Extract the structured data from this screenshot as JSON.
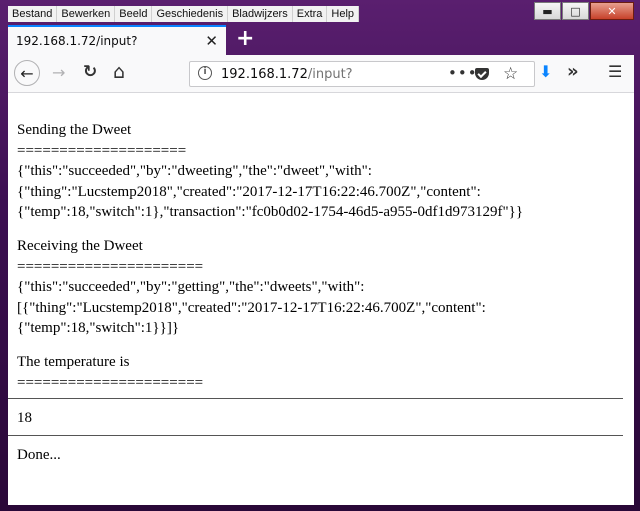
{
  "menu": [
    "Bestand",
    "Bewerken",
    "Beeld",
    "Geschiedenis",
    "Bladwijzers",
    "Extra",
    "Help"
  ],
  "window_controls": {
    "minimize": "▬",
    "maximize": "□",
    "close": "✕"
  },
  "tab": {
    "title": "192.168.1.72/input?",
    "close": "✕"
  },
  "newtab_label": "+",
  "nav": {
    "back": "←",
    "forward": "→",
    "reload": "↻",
    "home": "⌂"
  },
  "urlbar": {
    "host": "192.168.1.72",
    "path": "/input?",
    "info": "i",
    "more": "•••",
    "star": "☆"
  },
  "toolbar_right": {
    "download": "⬇",
    "overflow": "»",
    "menu": "☰"
  },
  "page": {
    "section1_title": "Sending the Dweet",
    "section1_rule": "====================",
    "section1_line1": "{\"this\":\"succeeded\",\"by\":\"dweeting\",\"the\":\"dweet\",\"with\":",
    "section1_line2": "{\"thing\":\"Lucstemp2018\",\"created\":\"2017-12-17T16:22:46.700Z\",\"content\":",
    "section1_line3": "{\"temp\":18,\"switch\":1},\"transaction\":\"fc0b0d02-1754-46d5-a955-0df1d973129f\"}}",
    "section2_title": "Receiving the Dweet",
    "section2_rule": "======================",
    "section2_line1": "{\"this\":\"succeeded\",\"by\":\"getting\",\"the\":\"dweets\",\"with\":",
    "section2_line2": "[{\"thing\":\"Lucstemp2018\",\"created\":\"2017-12-17T16:22:46.700Z\",\"content\":",
    "section2_line3": "{\"temp\":18,\"switch\":1}}]}",
    "section3_title": "The temperature is",
    "section3_rule": "======================",
    "temperature": "18",
    "status": "Done..."
  }
}
